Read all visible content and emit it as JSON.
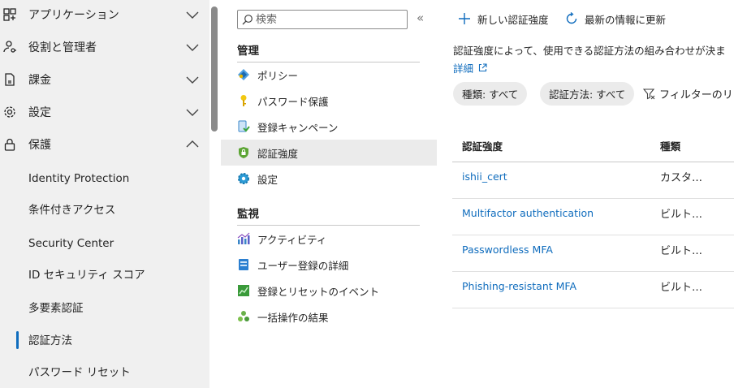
{
  "left_nav": {
    "items": [
      {
        "label": "アプリケーション",
        "icon": "app-grid-icon",
        "expanded": false
      },
      {
        "label": "役割と管理者",
        "icon": "person-key-icon",
        "expanded": false
      },
      {
        "label": "課金",
        "icon": "document-icon",
        "expanded": false
      },
      {
        "label": "設定",
        "icon": "gear-icon",
        "expanded": false
      },
      {
        "label": "保護",
        "icon": "lock-icon",
        "expanded": true
      }
    ],
    "sub_items": [
      {
        "label": "Identity Protection"
      },
      {
        "label": "条件付きアクセス"
      },
      {
        "label": "Security Center"
      },
      {
        "label": "ID セキュリティ スコア"
      },
      {
        "label": "多要素認証"
      },
      {
        "label": "認証方法",
        "selected": true
      },
      {
        "label": "パスワード リセット"
      }
    ]
  },
  "menu": {
    "search_placeholder": "検索",
    "collapse_glyph": "«",
    "sections": [
      {
        "title": "管理",
        "items": [
          {
            "label": "ポリシー",
            "icon": "policy-icon"
          },
          {
            "label": "パスワード保護",
            "icon": "key-icon"
          },
          {
            "label": "登録キャンペーン",
            "icon": "campaign-icon"
          },
          {
            "label": "認証強度",
            "icon": "shield-lock-icon",
            "selected": true
          },
          {
            "label": "設定",
            "icon": "settings-gear-icon"
          }
        ]
      },
      {
        "title": "監視",
        "items": [
          {
            "label": "アクティビティ",
            "icon": "activity-chart-icon"
          },
          {
            "label": "ユーザー登録の詳細",
            "icon": "user-registration-icon"
          },
          {
            "label": "登録とリセットのイベント",
            "icon": "events-chart-icon"
          },
          {
            "label": "一括操作の結果",
            "icon": "bulk-operations-icon"
          }
        ]
      }
    ]
  },
  "content": {
    "toolbar": {
      "new_label": "新しい認証強度",
      "refresh_label": "最新の情報に更新"
    },
    "description": "認証強度によって、使用できる認証方法の組み合わせが決ま",
    "details_link": "詳細",
    "filters": [
      {
        "label": "種類: すべて"
      },
      {
        "label": "認証方法: すべて"
      }
    ],
    "filter_button": "フィルターのリ",
    "table": {
      "columns": [
        "認証強度",
        "種類"
      ],
      "rows": [
        {
          "name": "ishii_cert",
          "type": "カスタ…"
        },
        {
          "name": "Multifactor authentication",
          "type": "ビルト…"
        },
        {
          "name": "Passwordless MFA",
          "type": "ビルト…"
        },
        {
          "name": "Phishing-resistant MFA",
          "type": "ビルト…"
        }
      ]
    }
  },
  "colors": {
    "accent": "#0f6cbd",
    "nav_bg": "#f0f0f0",
    "selected_bg": "#ebebeb"
  }
}
